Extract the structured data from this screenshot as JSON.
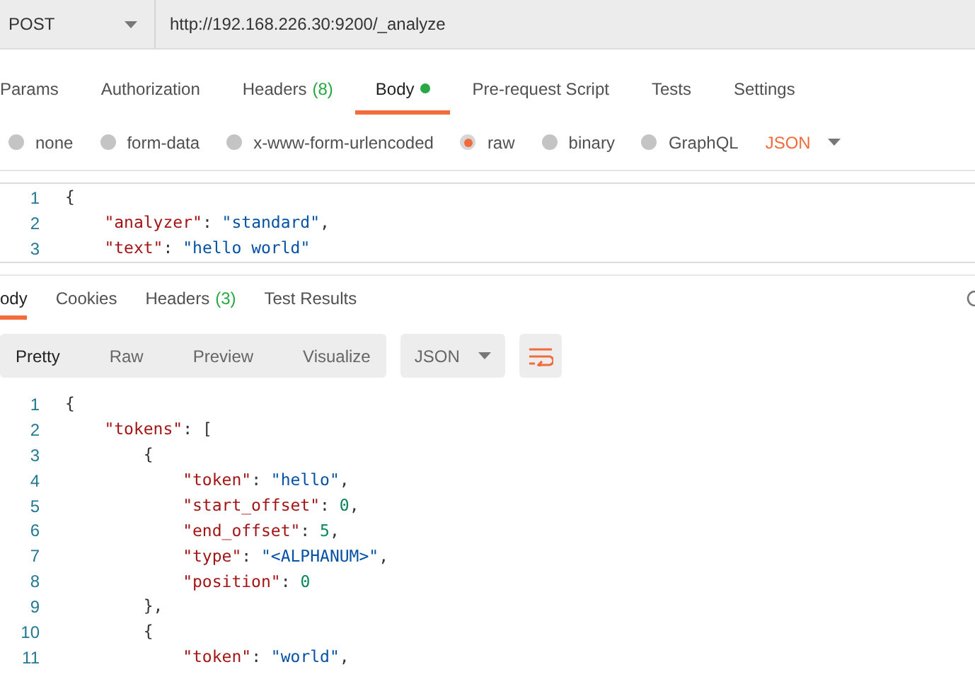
{
  "request": {
    "method": "POST",
    "url": "http://192.168.226.30:9200/_analyze"
  },
  "request_tabs": [
    {
      "label": "Params",
      "selected": false
    },
    {
      "label": "Authorization",
      "selected": false
    },
    {
      "label": "Headers",
      "count": "(8)",
      "selected": false
    },
    {
      "label": "Body",
      "dot": true,
      "selected": true
    },
    {
      "label": "Pre-request Script",
      "selected": false
    },
    {
      "label": "Tests",
      "selected": false
    },
    {
      "label": "Settings",
      "selected": false
    }
  ],
  "body_types": [
    {
      "label": "none",
      "selected": false
    },
    {
      "label": "form-data",
      "selected": false
    },
    {
      "label": "x-www-form-urlencoded",
      "selected": false
    },
    {
      "label": "raw",
      "selected": true
    },
    {
      "label": "binary",
      "selected": false
    },
    {
      "label": "GraphQL",
      "selected": false
    }
  ],
  "body_format": "JSON",
  "request_body": [
    {
      "number": "1",
      "tokens": [
        {
          "kind": "punct",
          "text": "{"
        }
      ]
    },
    {
      "number": "2",
      "tokens": [
        {
          "kind": "key",
          "text": "    \"analyzer\""
        },
        {
          "kind": "punct",
          "text": ": "
        },
        {
          "kind": "string",
          "text": "\"standard\""
        },
        {
          "kind": "punct",
          "text": ","
        }
      ]
    },
    {
      "number": "3",
      "tokens": [
        {
          "kind": "key",
          "text": "    \"text\""
        },
        {
          "kind": "punct",
          "text": ": "
        },
        {
          "kind": "string",
          "text": "\"hello world\""
        }
      ]
    }
  ],
  "response_tabs": [
    {
      "label": "ody",
      "selected": true
    },
    {
      "label": "Cookies",
      "selected": false
    },
    {
      "label": "Headers",
      "count": "(3)",
      "selected": false
    },
    {
      "label": "Test Results",
      "selected": false
    }
  ],
  "view_modes": [
    {
      "label": "Pretty",
      "selected": true
    },
    {
      "label": "Raw",
      "selected": false
    },
    {
      "label": "Preview",
      "selected": false
    },
    {
      "label": "Visualize",
      "selected": false
    }
  ],
  "response_format": "JSON",
  "response_body": [
    {
      "number": "1",
      "tokens": [
        {
          "kind": "punct",
          "text": "{"
        }
      ]
    },
    {
      "number": "2",
      "tokens": [
        {
          "kind": "key",
          "text": "    \"tokens\""
        },
        {
          "kind": "punct",
          "text": ": ["
        }
      ]
    },
    {
      "number": "3",
      "tokens": [
        {
          "kind": "punct",
          "text": "        {"
        }
      ]
    },
    {
      "number": "4",
      "tokens": [
        {
          "kind": "key",
          "text": "            \"token\""
        },
        {
          "kind": "punct",
          "text": ": "
        },
        {
          "kind": "string",
          "text": "\"hello\""
        },
        {
          "kind": "punct",
          "text": ","
        }
      ]
    },
    {
      "number": "5",
      "tokens": [
        {
          "kind": "key",
          "text": "            \"start_offset\""
        },
        {
          "kind": "punct",
          "text": ": "
        },
        {
          "kind": "number",
          "text": "0"
        },
        {
          "kind": "punct",
          "text": ","
        }
      ]
    },
    {
      "number": "6",
      "tokens": [
        {
          "kind": "key",
          "text": "            \"end_offset\""
        },
        {
          "kind": "punct",
          "text": ": "
        },
        {
          "kind": "number",
          "text": "5"
        },
        {
          "kind": "punct",
          "text": ","
        }
      ]
    },
    {
      "number": "7",
      "tokens": [
        {
          "kind": "key",
          "text": "            \"type\""
        },
        {
          "kind": "punct",
          "text": ": "
        },
        {
          "kind": "string",
          "text": "\"<ALPHANUM>\""
        },
        {
          "kind": "punct",
          "text": ","
        }
      ]
    },
    {
      "number": "8",
      "tokens": [
        {
          "kind": "key",
          "text": "            \"position\""
        },
        {
          "kind": "punct",
          "text": ": "
        },
        {
          "kind": "number",
          "text": "0"
        }
      ]
    },
    {
      "number": "9",
      "tokens": [
        {
          "kind": "punct",
          "text": "        },"
        }
      ]
    },
    {
      "number": "10",
      "tokens": [
        {
          "kind": "punct",
          "text": "        {"
        }
      ]
    },
    {
      "number": "11",
      "tokens": [
        {
          "kind": "key",
          "text": "            \"token\""
        },
        {
          "kind": "punct",
          "text": ": "
        },
        {
          "kind": "string",
          "text": "\"world\""
        },
        {
          "kind": "punct",
          "text": ","
        }
      ]
    }
  ]
}
